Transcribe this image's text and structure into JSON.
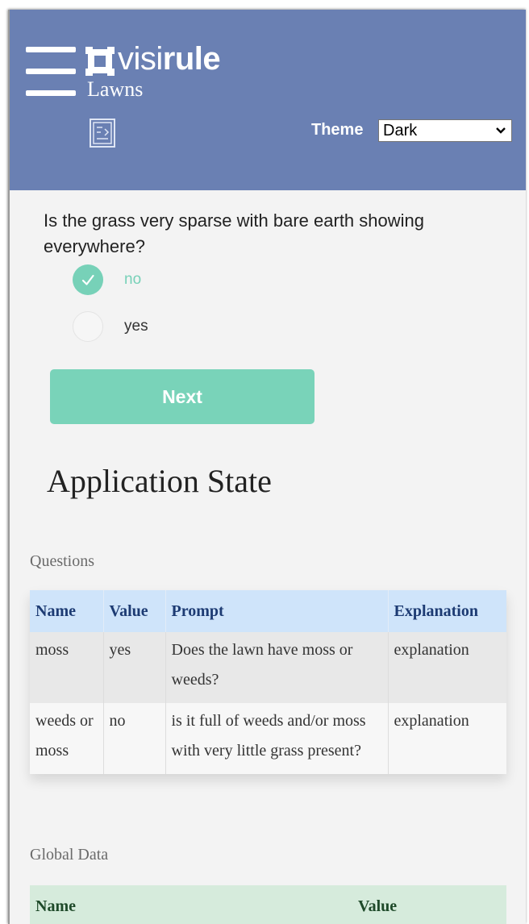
{
  "header": {
    "brand_light": "visi",
    "brand_bold": "rule",
    "app_title": "Lawns",
    "theme_label": "Theme",
    "theme_value": "Dark",
    "background_color": "#6a80b3"
  },
  "question": {
    "text": "Is the grass very sparse with bare earth showing everywhere?",
    "options": [
      {
        "label": "no",
        "selected": true
      },
      {
        "label": "yes",
        "selected": false
      }
    ],
    "accent_color": "#77d1b8"
  },
  "next_button": {
    "label": "Next"
  },
  "state": {
    "title": "Application State",
    "questions_caption": "Questions",
    "questions_columns": [
      "Name",
      "Value",
      "Prompt",
      "Explanation"
    ],
    "questions_rows": [
      {
        "name": "moss",
        "value": "yes",
        "prompt": "Does the lawn have moss or weeds?",
        "explanation": "explanation"
      },
      {
        "name": "weeds or moss",
        "value": "no",
        "prompt": "is it full of weeds and/or moss with very little grass present?",
        "explanation": "explanation"
      }
    ],
    "global_caption": "Global Data",
    "global_columns": [
      "Name",
      "Value"
    ]
  },
  "icons": {
    "menu": "hamburger-menu-icon",
    "logo": "visirule-logo-icon",
    "small": "document-icon",
    "select": "chevron-down-icon",
    "check": "check-icon"
  }
}
